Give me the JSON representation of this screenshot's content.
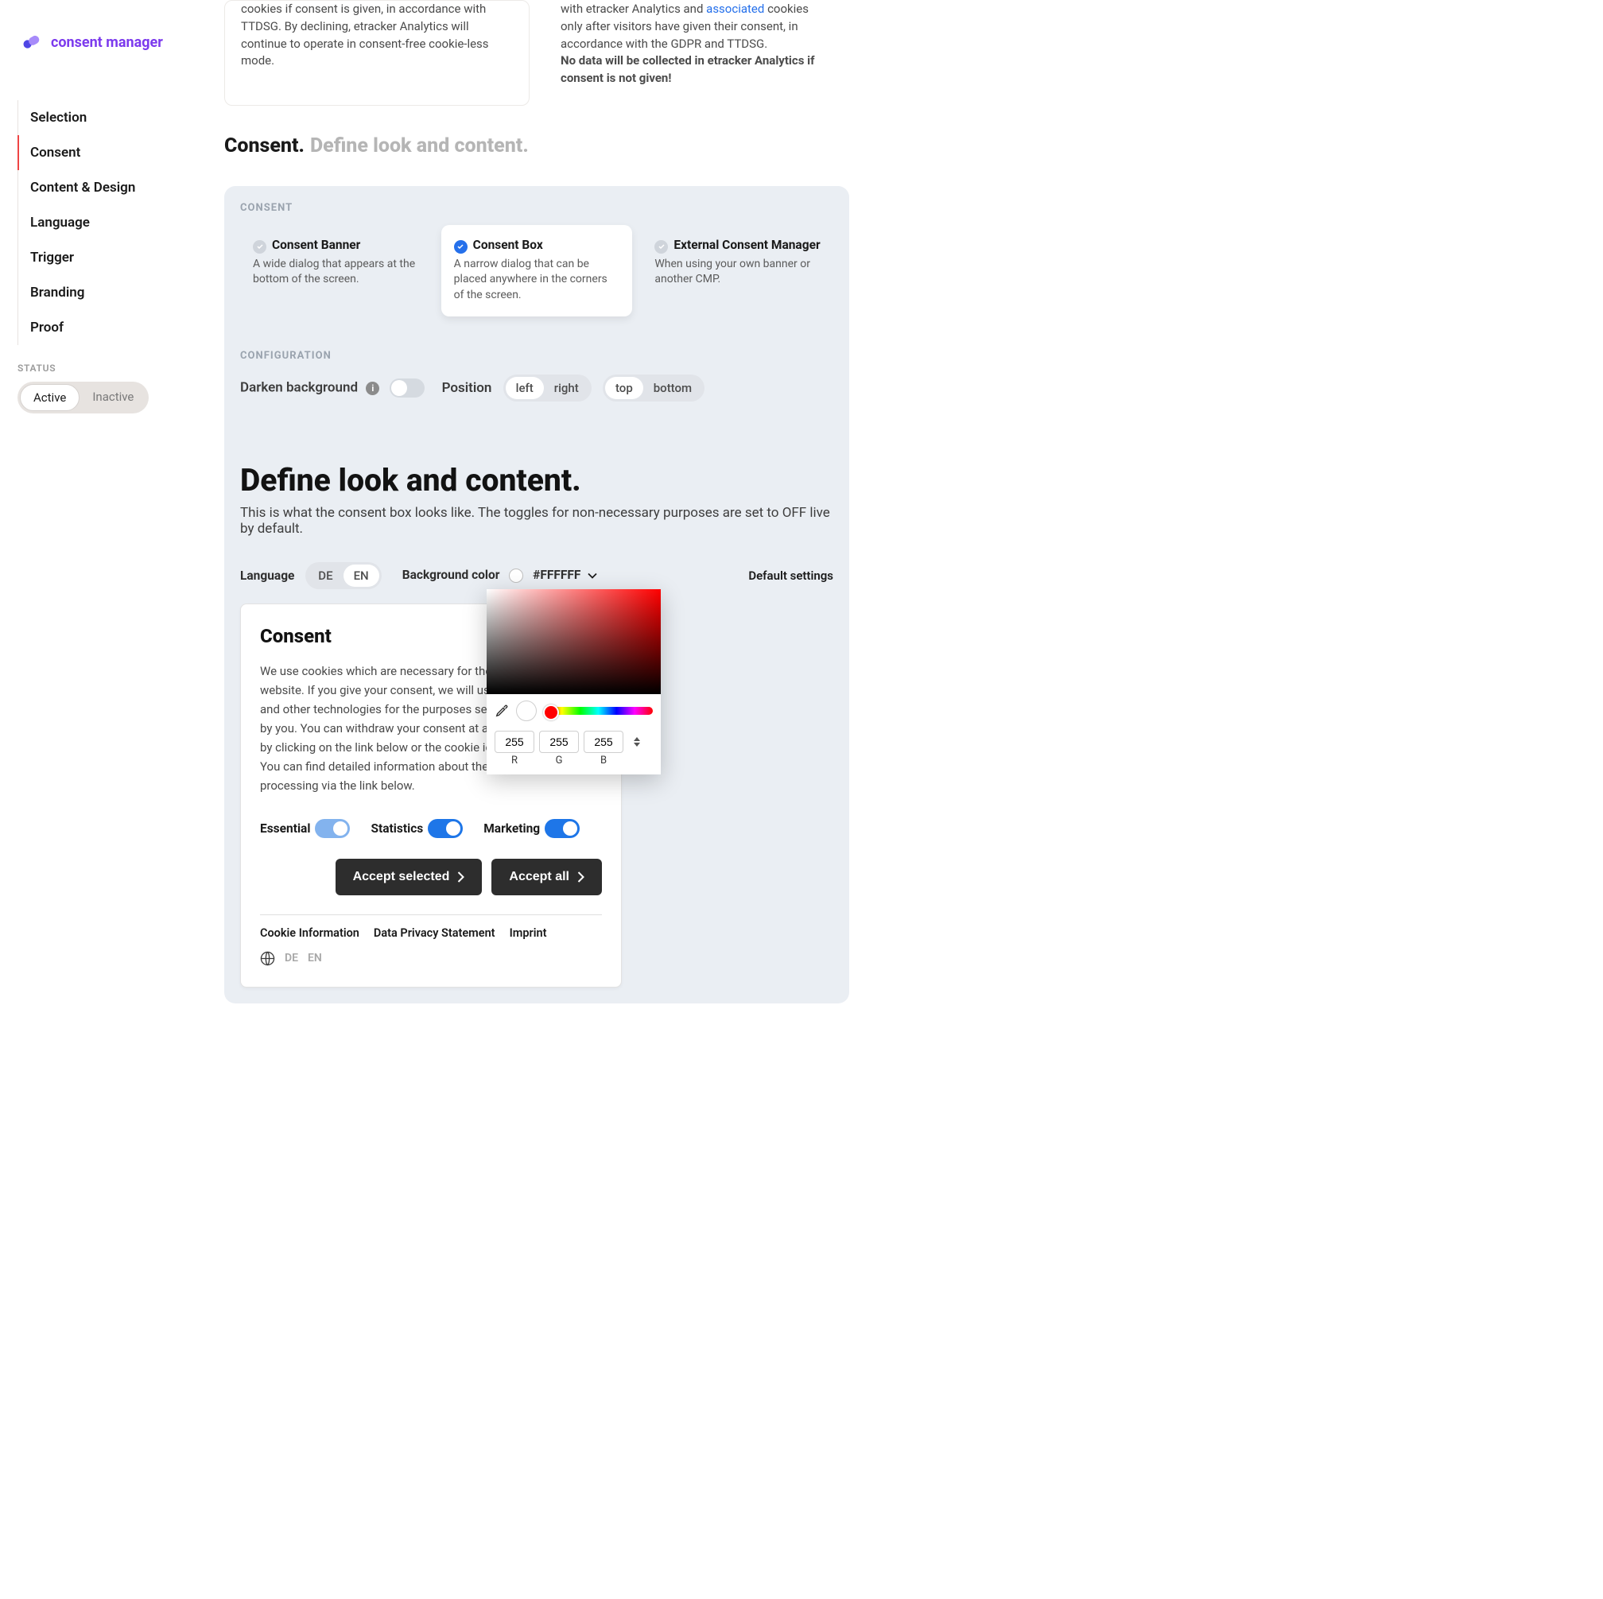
{
  "brand": {
    "name": "consent manager"
  },
  "sidebar": {
    "items": [
      {
        "label": "Selection"
      },
      {
        "label": "Consent"
      },
      {
        "label": "Content & Design"
      },
      {
        "label": "Language"
      },
      {
        "label": "Trigger"
      },
      {
        "label": "Branding"
      },
      {
        "label": "Proof"
      }
    ],
    "status_label": "STATUS",
    "status": {
      "active": "Active",
      "inactive": "Inactive"
    }
  },
  "topcards": {
    "left": "cookies if consent is given, in accordance with TTDSG. By declining, etracker Analytics will continue to operate in consent-free cookie-less mode.",
    "right_a": "with etracker Analytics and ",
    "right_link": "associated",
    "right_b": " cookies only after visitors have given their consent, in accordance with the GDPR and TTDSG.",
    "right_bold": "No data will be collected in etracker Analytics if consent is not given!"
  },
  "section": {
    "title": "Consent.",
    "subtitle": "Define look and content."
  },
  "consent_panel": {
    "label": "CONSENT",
    "options": [
      {
        "title": "Consent Banner",
        "desc": "A wide dialog that appears at the bottom of the screen."
      },
      {
        "title": "Consent Box",
        "desc": "A narrow dialog that can be placed anywhere in the corners of the screen."
      },
      {
        "title": "External Consent Manager",
        "desc": "When using your own banner or another CMP."
      }
    ]
  },
  "config": {
    "label": "CONFIGURATION",
    "darken": "Darken background",
    "position": "Position",
    "left": "left",
    "right": "right",
    "top": "top",
    "bottom": "bottom"
  },
  "define": {
    "heading": "Define look and content.",
    "sub": "This is what the consent box looks like. The toggles for non-necessary purposes are set to OFF live by default.",
    "language": "Language",
    "de": "DE",
    "en": "EN",
    "bg": "Background color",
    "hex": "#FFFFFF",
    "default": "Default settings"
  },
  "consent_box": {
    "title": "Consent",
    "body": "We use cookies which are necessary for the operation of the website. If you give your consent, we will use additional cookies and other technologies for the purposes selected and accepted by you. You can withdraw your consent at any time for the future by clicking on the link below or the cookie icon on each page. You can find detailed information about these cookies and data processing via the link below.",
    "purposes": {
      "essential": "Essential",
      "statistics": "Statistics",
      "marketing": "Marketing"
    },
    "accept_selected": "Accept selected",
    "accept_all": "Accept all",
    "legal": {
      "cookie": "Cookie Information",
      "privacy": "Data Privacy Statement",
      "imprint": "Imprint"
    },
    "lang": {
      "de": "DE",
      "en": "EN"
    }
  },
  "colorpicker": {
    "r": "255",
    "g": "255",
    "b": "255",
    "R": "R",
    "G": "G",
    "B": "B"
  }
}
